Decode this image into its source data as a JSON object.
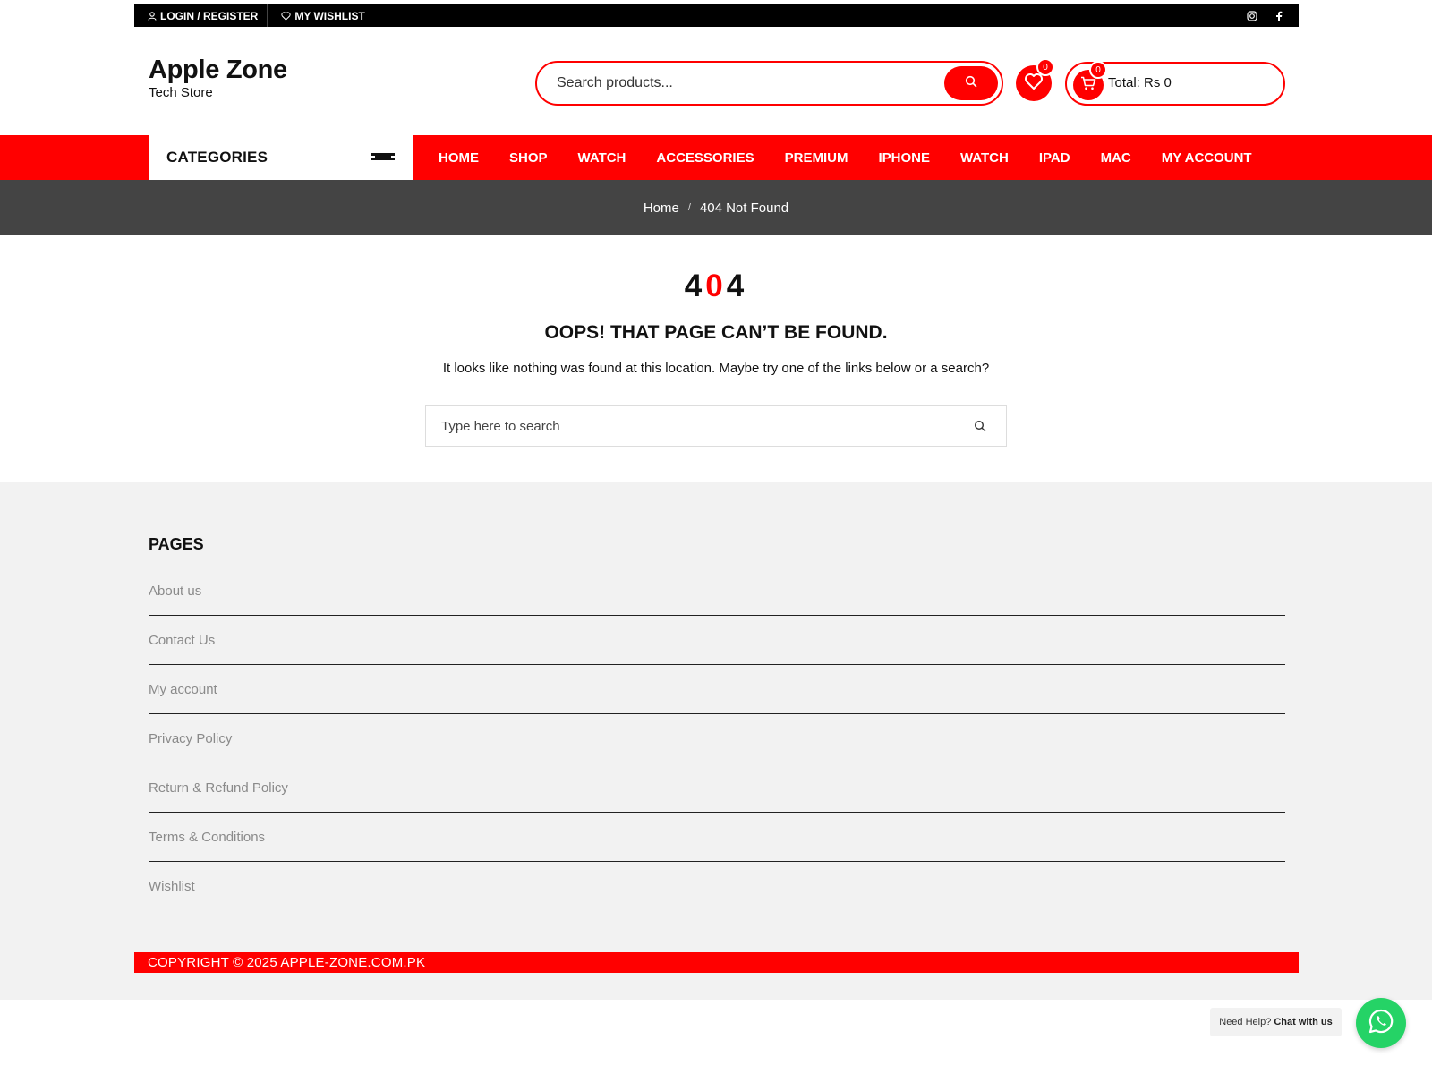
{
  "topbar": {
    "login_label": "LOGIN / REGISTER",
    "wishlist_label": "MY WISHLIST",
    "social_icons": [
      "instagram-icon",
      "facebook-icon"
    ]
  },
  "header": {
    "site_title": "Apple Zone",
    "tagline": "Tech Store",
    "search_placeholder": "Search products...",
    "wishlist_count": "0",
    "cart_count": "0",
    "cart_total": "Total: Rs 0"
  },
  "nav": {
    "categories_label": "CATEGORIES",
    "items": [
      "HOME",
      "SHOP",
      "WATCH",
      "ACCESSORIES",
      "PREMIUM",
      "IPHONE",
      "WATCH",
      "IPAD",
      "MAC",
      "MY ACCOUNT"
    ]
  },
  "breadcrumb": {
    "home": "Home",
    "separator": "/",
    "current": "404 Not Found"
  },
  "error": {
    "code_left": "4",
    "code_mid": "0",
    "code_right": "4",
    "title": "OOPS! THAT PAGE CAN’T BE FOUND.",
    "message": "It looks like nothing was found at this location. Maybe try one of the links below or a search?",
    "search_placeholder": "Type here to search"
  },
  "footer": {
    "pages_title": "PAGES",
    "pages": [
      "About us",
      "Contact Us",
      "My account",
      "Privacy Policy",
      "Return & Refund Policy",
      "Terms & Conditions",
      "Wishlist"
    ],
    "copyright": "COPYRIGHT © 2025 APPLE-ZONE.COM.PK"
  },
  "chat": {
    "prefix": "Need Help?",
    "label": "Chat with us"
  },
  "colors": {
    "accent": "#ff0000",
    "topbar": "#000000",
    "breadcrumb_band": "#444444",
    "footer_bg": "#f2f2f2",
    "whatsapp": "#25d366"
  }
}
